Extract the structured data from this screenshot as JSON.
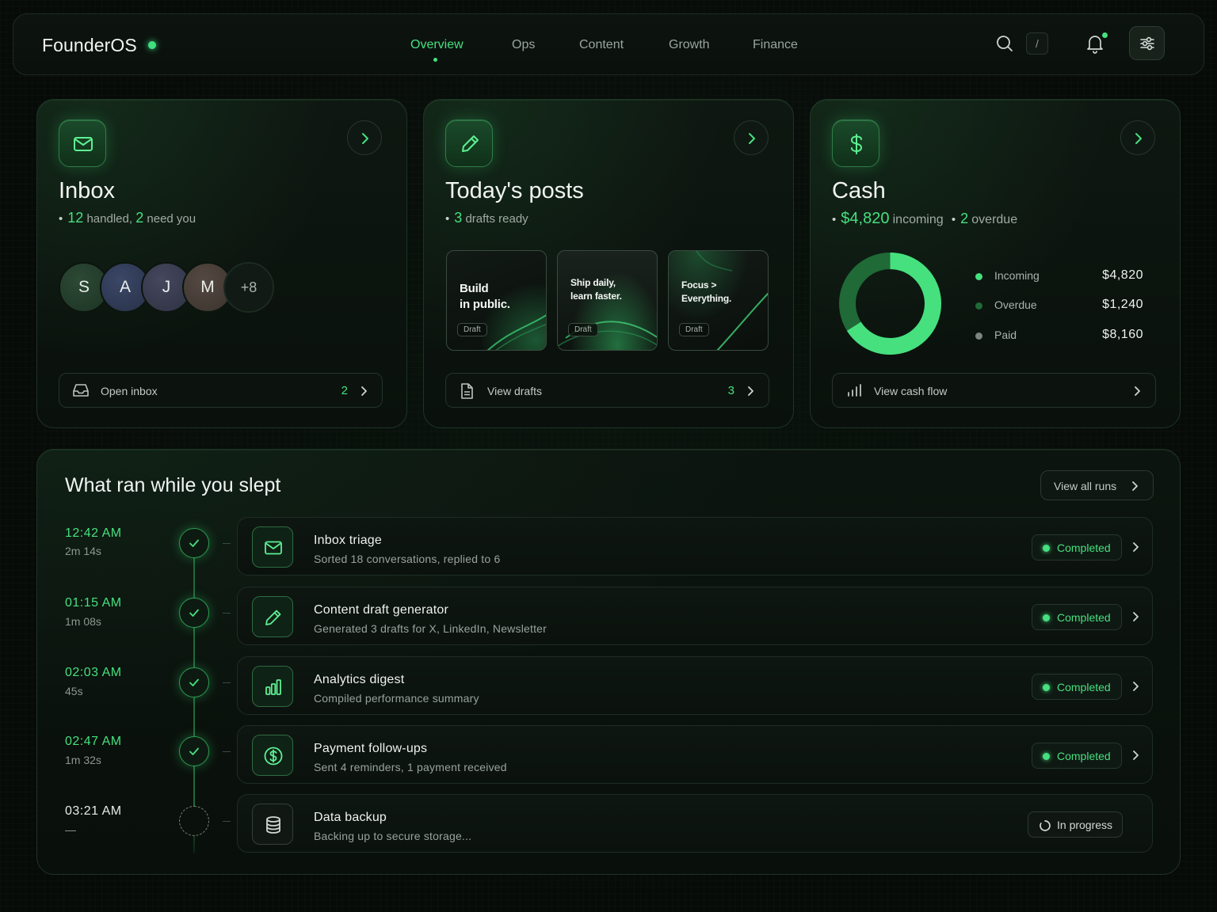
{
  "app": {
    "name": "FounderOS",
    "colors": {
      "accent": "#46e07f",
      "background": "#070b08"
    }
  },
  "nav": {
    "items": [
      "Overview",
      "Ops",
      "Content",
      "Growth",
      "Finance"
    ],
    "active": "Overview",
    "search_shortcut": "/",
    "icons": [
      "search-icon",
      "bell-icon",
      "settings-sliders-icon"
    ]
  },
  "cards": {
    "inbox": {
      "title": "Inbox",
      "handled_count": "12",
      "handled_label": "handled,",
      "need_count": "2",
      "need_label": "need you",
      "avatars": [
        "S",
        "A",
        "J",
        "M"
      ],
      "more": "+8",
      "footer_label": "Open inbox",
      "footer_count": "2"
    },
    "posts": {
      "title": "Today's posts",
      "drafts_count": "3",
      "drafts_label": "drafts ready",
      "thumbs": [
        {
          "line1": "Build",
          "line2": "in public.",
          "badge": "Draft"
        },
        {
          "line1": "Ship daily,",
          "line2": "learn faster.",
          "badge": "Draft"
        },
        {
          "line1": "Focus >",
          "line2": "Everything.",
          "badge": "Draft"
        }
      ],
      "footer_label": "View drafts",
      "footer_count": "3"
    },
    "cash": {
      "title": "Cash",
      "incoming_value": "$4,820",
      "incoming_label": "incoming",
      "overdue_count": "2",
      "overdue_label": "overdue",
      "legend": [
        {
          "label": "Incoming",
          "value": "$4,820",
          "color": "#46e07f"
        },
        {
          "label": "Overdue",
          "value": "$1,240",
          "color": "#1f6a37"
        },
        {
          "label": "Paid",
          "value": "$8,160",
          "color": "#7c857f"
        }
      ],
      "donut": {
        "incoming_fraction": 0.66,
        "overdue_fraction": 0.34
      },
      "footer_label": "View cash flow"
    }
  },
  "timeline": {
    "title": "What ran while you slept",
    "view_all": "View all runs",
    "runs": [
      {
        "time": "12:42 AM",
        "duration": "2m 14s",
        "title": "Inbox triage",
        "desc": "Sorted 18 conversations, replied to 6",
        "status": "Completed",
        "icon": "mail-icon"
      },
      {
        "time": "01:15 AM",
        "duration": "1m 08s",
        "title": "Content draft generator",
        "desc": "Generated 3 drafts for X, LinkedIn, Newsletter",
        "status": "Completed",
        "icon": "pencil-icon"
      },
      {
        "time": "02:03 AM",
        "duration": "45s",
        "title": "Analytics digest",
        "desc": "Compiled performance summary",
        "status": "Completed",
        "icon": "bar-chart-icon"
      },
      {
        "time": "02:47 AM",
        "duration": "1m 32s",
        "title": "Payment follow-ups",
        "desc": "Sent 4 reminders, 1 payment received",
        "status": "Completed",
        "icon": "dollar-icon"
      },
      {
        "time": "03:21 AM",
        "duration": "—",
        "title": "Data backup",
        "desc": "Backing up to secure storage...",
        "status": "In progress",
        "icon": "database-icon"
      }
    ]
  }
}
